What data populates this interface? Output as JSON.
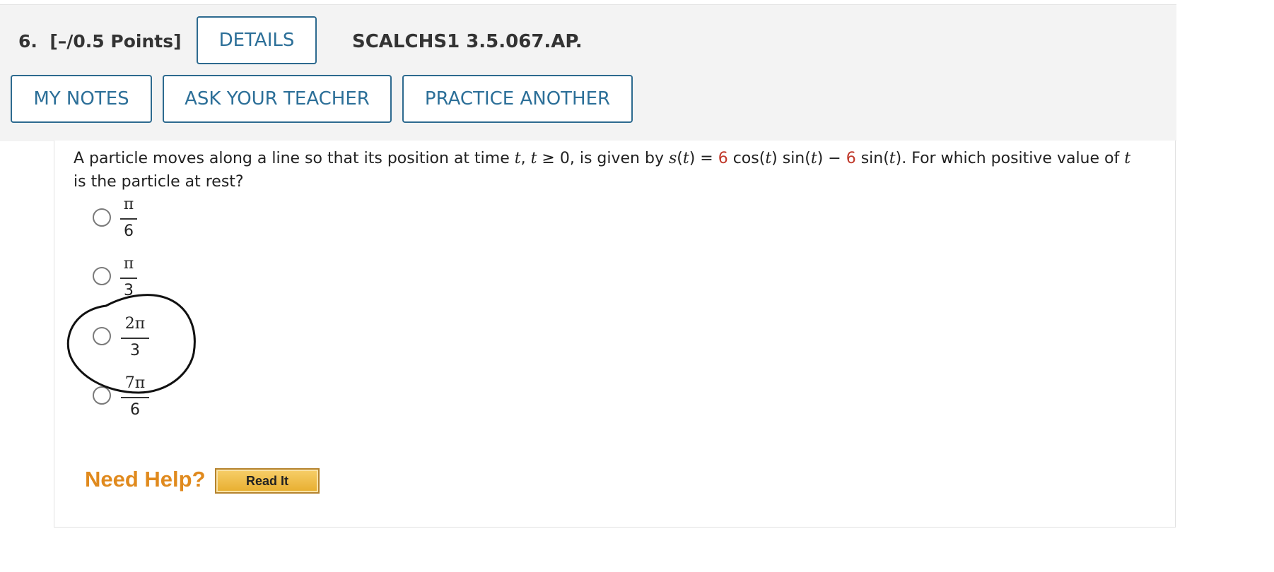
{
  "header": {
    "question_number": "6.",
    "points": "[–/0.5 Points]",
    "details_label": "DETAILS",
    "assignment_code": "SCALCHS1 3.5.067.AP.",
    "my_notes_label": "MY NOTES",
    "ask_teacher_label": "ASK YOUR TEACHER",
    "practice_another_label": "PRACTICE ANOTHER"
  },
  "question": {
    "part1": "A particle moves along a line so that its position at time ",
    "t1": "t",
    "part2": ", ",
    "t2": "t",
    "part3": " ≥ 0, is given by ",
    "s": "s",
    "part4": "(",
    "t3": "t",
    "part5": ") = ",
    "coef1": "6",
    "part6": " cos(",
    "t4": "t",
    "part7": ") sin(",
    "t5": "t",
    "part8": ") − ",
    "coef2": "6",
    "part9": " sin(",
    "t6": "t",
    "part10": "). For which positive value of ",
    "t7": "t",
    "part11": " is the particle at rest?"
  },
  "options": [
    {
      "numerator": "π",
      "denominator": "6",
      "selected": false
    },
    {
      "numerator": "π",
      "denominator": "3",
      "selected": false
    },
    {
      "numerator": "2π",
      "denominator": "3",
      "selected": false
    },
    {
      "numerator": "7π",
      "denominator": "6",
      "selected": false
    }
  ],
  "help": {
    "need_help_label": "Need Help?",
    "read_it_label": "Read It"
  },
  "colors": {
    "button_text": "#2c6f98",
    "button_border": "#2d6a8f",
    "coefficient_red": "#c0392b",
    "need_help_orange": "#e08a1e",
    "read_it_gold": "#e7ad2e",
    "header_bg": "#f3f3f3"
  }
}
